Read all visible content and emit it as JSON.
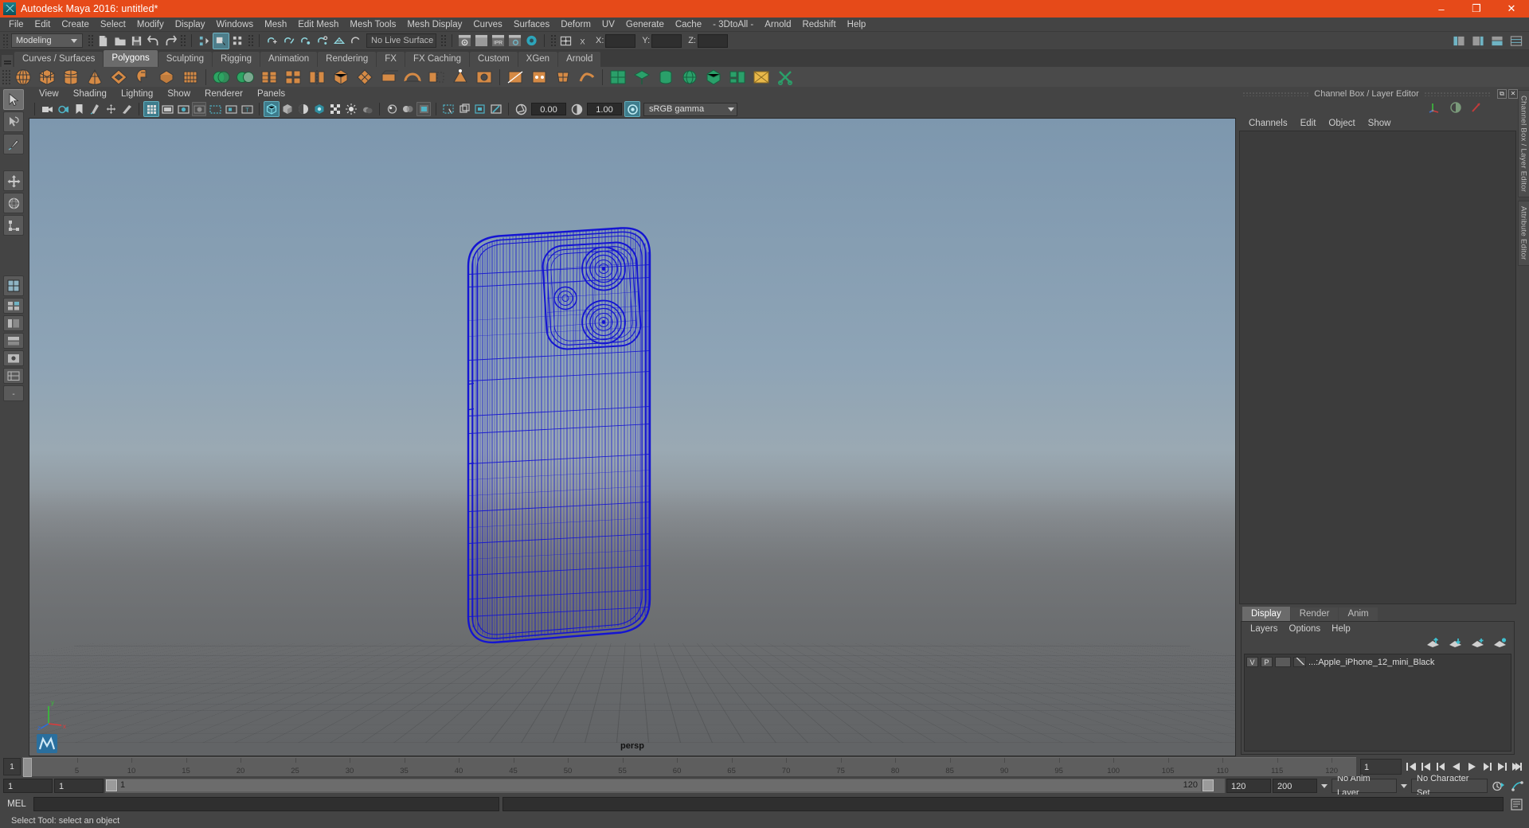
{
  "window": {
    "title": "Autodesk Maya 2016: untitled*",
    "app_icon": "maya-icon",
    "minimize": "–",
    "maximize": "❐",
    "close": "✕",
    "accent_color": "#e64a19"
  },
  "menubar": {
    "items": [
      "File",
      "Edit",
      "Create",
      "Select",
      "Modify",
      "Display",
      "Windows",
      "Mesh",
      "Edit Mesh",
      "Mesh Tools",
      "Mesh Display",
      "Curves",
      "Surfaces",
      "Deform",
      "UV",
      "Generate",
      "Cache",
      "- 3DtoAll -",
      "Arnold",
      "Redshift",
      "Help"
    ]
  },
  "statusline": {
    "menu_set": "Modeling",
    "live_surface": "No Live Surface",
    "coord_labels": [
      "X:",
      "Y:",
      "Z:"
    ],
    "coord_values": [
      "",
      "",
      ""
    ],
    "icons": [
      "new-scene-icon",
      "open-scene-icon",
      "save-scene-icon",
      "undo-icon",
      "redo-icon",
      "select-by-hierarchy-icon",
      "select-by-object-icon",
      "select-by-component-icon",
      "snap-to-grid-icon",
      "snap-to-curve-icon",
      "snap-to-point-icon",
      "snap-to-projected-center-icon",
      "snap-to-view-plane-icon",
      "make-live-icon",
      "render-view-icon",
      "render-sequence-icon",
      "ipr-render-icon",
      "render-settings-icon",
      "hypershade-icon",
      "editor-layout-icon",
      "xgen-icon"
    ],
    "right_icons": [
      "show-hide-modeling-toolkit-icon",
      "show-hide-attribute-editor-icon",
      "show-hide-tool-settings-icon",
      "show-hide-channel-box-icon"
    ]
  },
  "shelf": {
    "tabs": [
      "Curves / Surfaces",
      "Polygons",
      "Sculpting",
      "Rigging",
      "Animation",
      "Rendering",
      "FX",
      "FX Caching",
      "Custom",
      "XGen",
      "Arnold"
    ],
    "active_tab": "Polygons",
    "icons": [
      "poly-sphere-icon",
      "poly-cube-icon",
      "poly-cylinder-icon",
      "poly-cone-icon",
      "poly-torus-icon",
      "poly-plane-icon",
      "poly-disc-icon",
      "poly-platonic-icon",
      "combine-icon",
      "separate-icon",
      "extract-icon",
      "booleans-icon",
      "mirror-icon",
      "smooth-icon",
      "bevel-icon",
      "extrude-icon",
      "bridge-icon",
      "append-icon",
      "merge-icon",
      "fill-hole-icon",
      "multi-cut-icon",
      "target-weld-icon",
      "quad-draw-icon",
      "sculpt-icon",
      "uv-editor-icon",
      "planar-map-icon",
      "cylindrical-map-icon",
      "spherical-map-icon",
      "automatic-map-icon",
      "uv-layout-icon",
      "uv-unfold-icon",
      "uv-cut-icon"
    ]
  },
  "toolbox": {
    "tools": [
      {
        "name": "select-tool",
        "icon": "arrow-icon",
        "selected": true
      },
      {
        "name": "lasso-tool",
        "icon": "lasso-arrow-icon",
        "selected": false
      },
      {
        "name": "paint-select-tool",
        "icon": "brush-icon",
        "selected": false
      },
      {
        "name": "move-tool",
        "icon": "move-icon",
        "selected": false
      },
      {
        "name": "rotate-tool",
        "icon": "rotate-icon",
        "selected": false
      },
      {
        "name": "scale-tool",
        "icon": "scale-icon",
        "selected": false
      }
    ],
    "layout_tools": [
      {
        "name": "single-perspective-view",
        "icon": "single-pane-icon"
      },
      {
        "name": "four-view-layout",
        "icon": "four-pane-icon"
      },
      {
        "name": "persp-outliner-layout",
        "icon": "persp-outliner-icon"
      },
      {
        "name": "persp-graph-layout",
        "icon": "persp-graph-icon"
      },
      {
        "name": "hypershade-layout",
        "icon": "hypershade-layout-icon"
      },
      {
        "name": "outliner-persp-layout",
        "icon": "outliner-persp-icon"
      },
      {
        "name": "more-layouts",
        "icon": "ellipsis-icon"
      }
    ]
  },
  "viewport": {
    "panel_menus": [
      "View",
      "Shading",
      "Lighting",
      "Show",
      "Renderer",
      "Panels"
    ],
    "camera_label": "persp",
    "exposure_value": "0.00",
    "gamma_value": "1.00",
    "color_management": "sRGB gamma",
    "toolbar_icons": [
      "select-camera-icon",
      "lock-camera-icon",
      "bookmark-icon",
      "image-plane-icon",
      "two-d-pan-zoom-icon",
      "grease-pencil-icon",
      "grid-toggle-icon",
      "film-gate-icon",
      "resolution-gate-icon",
      "gate-mask-icon",
      "film-origin-icon",
      "safe-action-icon",
      "field-chart-icon",
      "wireframe-on-shaded-icon",
      "smooth-shade-icon",
      "shaded-xray-icon",
      "xray-joints-icon",
      "texture-toggle-icon",
      "lights-toggle-icon",
      "shadows-icon",
      "screen-space-ao-icon",
      "motion-blur-icon",
      "multisample-icon",
      "depth-peeling-icon",
      "isolate-select-icon",
      "xray-all-icon",
      "xray-active-icon",
      "display-layers-icon",
      "exposure-icon",
      "contrast-icon",
      "color-management-icon"
    ],
    "axis_labels": [
      "x",
      "y",
      "z"
    ]
  },
  "channel_box": {
    "panel_title": "Channel Box / Layer Editor",
    "menus": [
      "Channels",
      "Edit",
      "Object",
      "Show"
    ],
    "icons": [
      "channel-box-icon",
      "attribute-editor-icon",
      "modeling-toolkit-icon"
    ],
    "maximize": "⧉",
    "close": "✕"
  },
  "layer_editor": {
    "tabs": [
      "Display",
      "Render",
      "Anim"
    ],
    "active_tab": "Display",
    "menus": [
      "Layers",
      "Options",
      "Help"
    ],
    "buttons": [
      "move-layer-up-icon",
      "move-layer-down-icon",
      "new-layer-icon",
      "new-layer-from-selected-icon"
    ],
    "layers": [
      {
        "visibility": "V",
        "playback": "P",
        "color": "",
        "name": "...:Apple_iPhone_12_mini_Black"
      }
    ]
  },
  "right_rail": {
    "tabs": [
      "Channel Box / Layer Editor",
      "Attribute Editor"
    ]
  },
  "timeline": {
    "start_frame": "1",
    "current_frame": "1",
    "ticks": [
      "5",
      "10",
      "15",
      "20",
      "25",
      "30",
      "35",
      "40",
      "45",
      "50",
      "55",
      "60",
      "65",
      "70",
      "75",
      "80",
      "85",
      "90",
      "95",
      "100",
      "105",
      "110",
      "115",
      "120"
    ],
    "frame_field": "1",
    "playback_buttons": [
      "go-to-start-icon",
      "step-back-key-icon",
      "step-back-frame-icon",
      "play-backwards-icon",
      "play-forwards-icon",
      "step-forward-frame-icon",
      "step-forward-key-icon",
      "go-to-end-icon"
    ]
  },
  "range": {
    "start": "1",
    "range_start": "1",
    "slider_min_label": "1",
    "slider_max_label": "120",
    "range_end": "120",
    "end": "200",
    "anim_layer": "No Anim Layer",
    "character_set": "No Character Set",
    "icons": [
      "auto-key-icon",
      "animation-preferences-icon"
    ]
  },
  "command_line": {
    "label": "MEL",
    "input_value": "",
    "script_editor_icon": "script-editor-icon"
  },
  "status_bar": {
    "help_text": "Select Tool: select an object"
  },
  "colors": {
    "wireframe": "#1414d2",
    "title_bar": "#e64a19",
    "panel_bg": "#444444",
    "shelf_icon": "#d58a45"
  }
}
